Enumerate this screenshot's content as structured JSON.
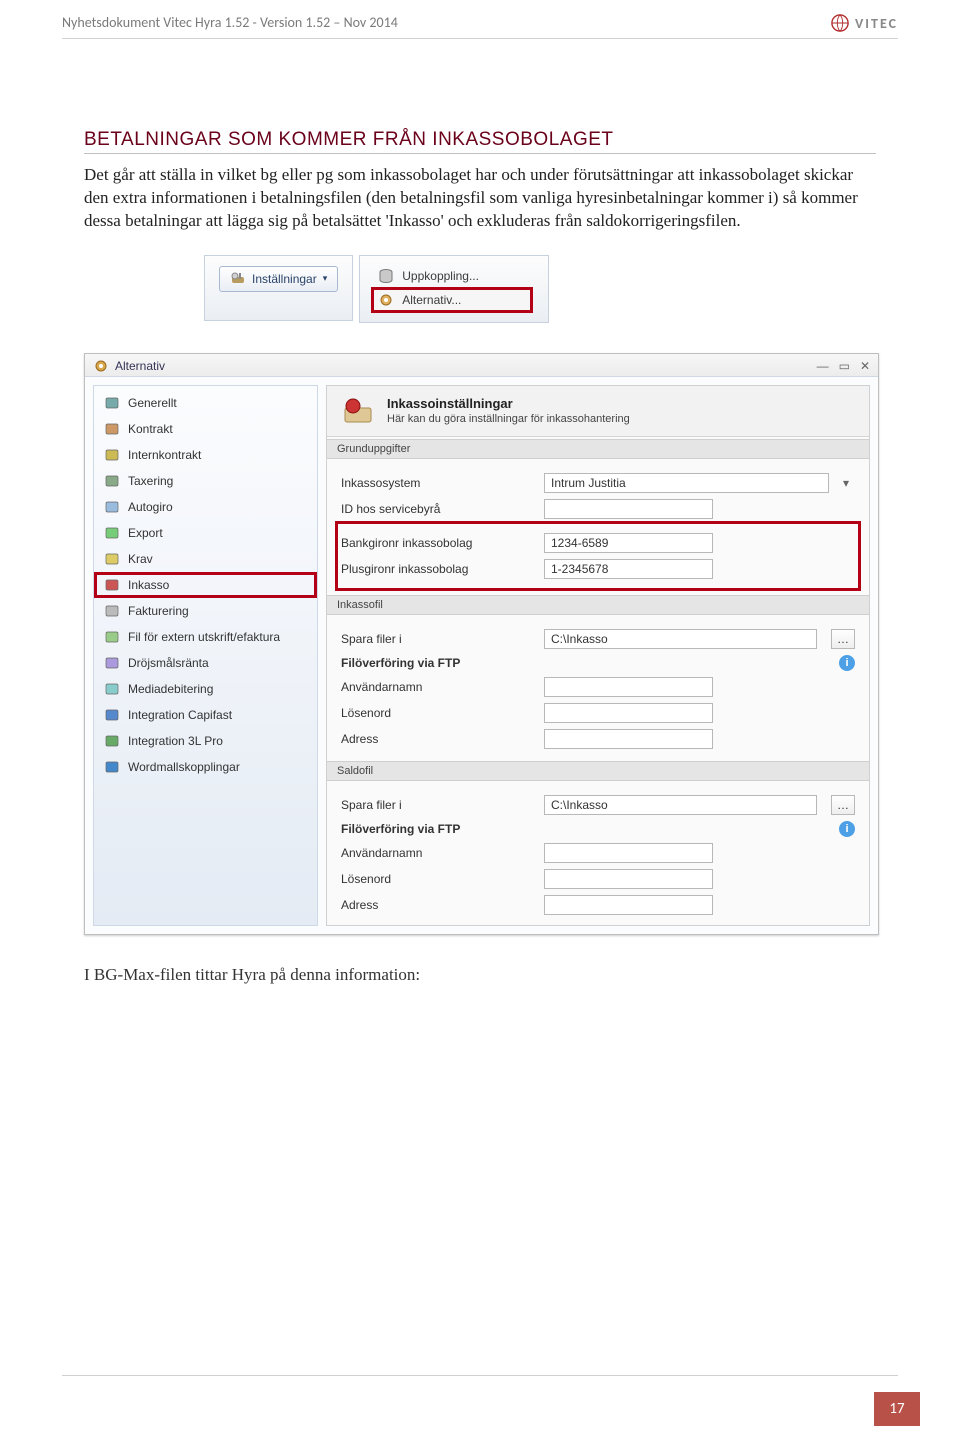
{
  "header": {
    "title": "Nyhetsdokument Vitec Hyra 1.52 - Version 1.52 – Nov 2014",
    "brand": "VITEC"
  },
  "heading": "BETALNINGAR SOM KOMMER FRÅN INKASSOBOLAGET",
  "body": "Det går att ställa in vilket bg eller pg som inkassobolaget har och under förutsättningar att inkassobolaget skickar den extra informationen i betalningsfilen (den betalningsfil som vanliga hyresinbetalningar kommer i) så kommer dessa betalningar att lägga sig på betalsättet 'Inkasso' och exkluderas från saldokorrigeringsfilen.",
  "ribbon": {
    "button": "Inställningar",
    "menu": [
      "Uppkoppling...",
      "Alternativ..."
    ]
  },
  "dialog": {
    "title": "Alternativ",
    "sidebar": [
      "Generellt",
      "Kontrakt",
      "Internkontrakt",
      "Taxering",
      "Autogiro",
      "Export",
      "Krav",
      "Inkasso",
      "Fakturering",
      "Fil för extern utskrift/efaktura",
      "Dröjsmålsränta",
      "Mediadebitering",
      "Integration Capifast",
      "Integration 3L Pro",
      "Wordmallskopplingar"
    ],
    "selected_index": 7,
    "panel": {
      "title": "Inkassoinställningar",
      "subtitle": "Här kan du göra inställningar för inkassohantering",
      "bands": {
        "grund": "Grunduppgifter",
        "inkassofil": "Inkassofil",
        "saldofil": "Saldofil"
      },
      "labels": {
        "system": "Inkassosystem",
        "id": "ID hos servicebyrå",
        "bg": "Bankgironr inkassobolag",
        "pg": "Plusgironr inkassobolag",
        "spara": "Spara filer i",
        "ftp": "Filöverföring via FTP",
        "user": "Användarnamn",
        "pass": "Lösenord",
        "addr": "Adress"
      },
      "values": {
        "system": "Intrum Justitia",
        "bg": "1234-6589",
        "pg": "1-2345678",
        "spara1": "C:\\Inkasso",
        "spara2": "C:\\Inkasso"
      }
    }
  },
  "footer_note": "I BG-Max-filen tittar Hyra på denna information:",
  "page_number": "17"
}
